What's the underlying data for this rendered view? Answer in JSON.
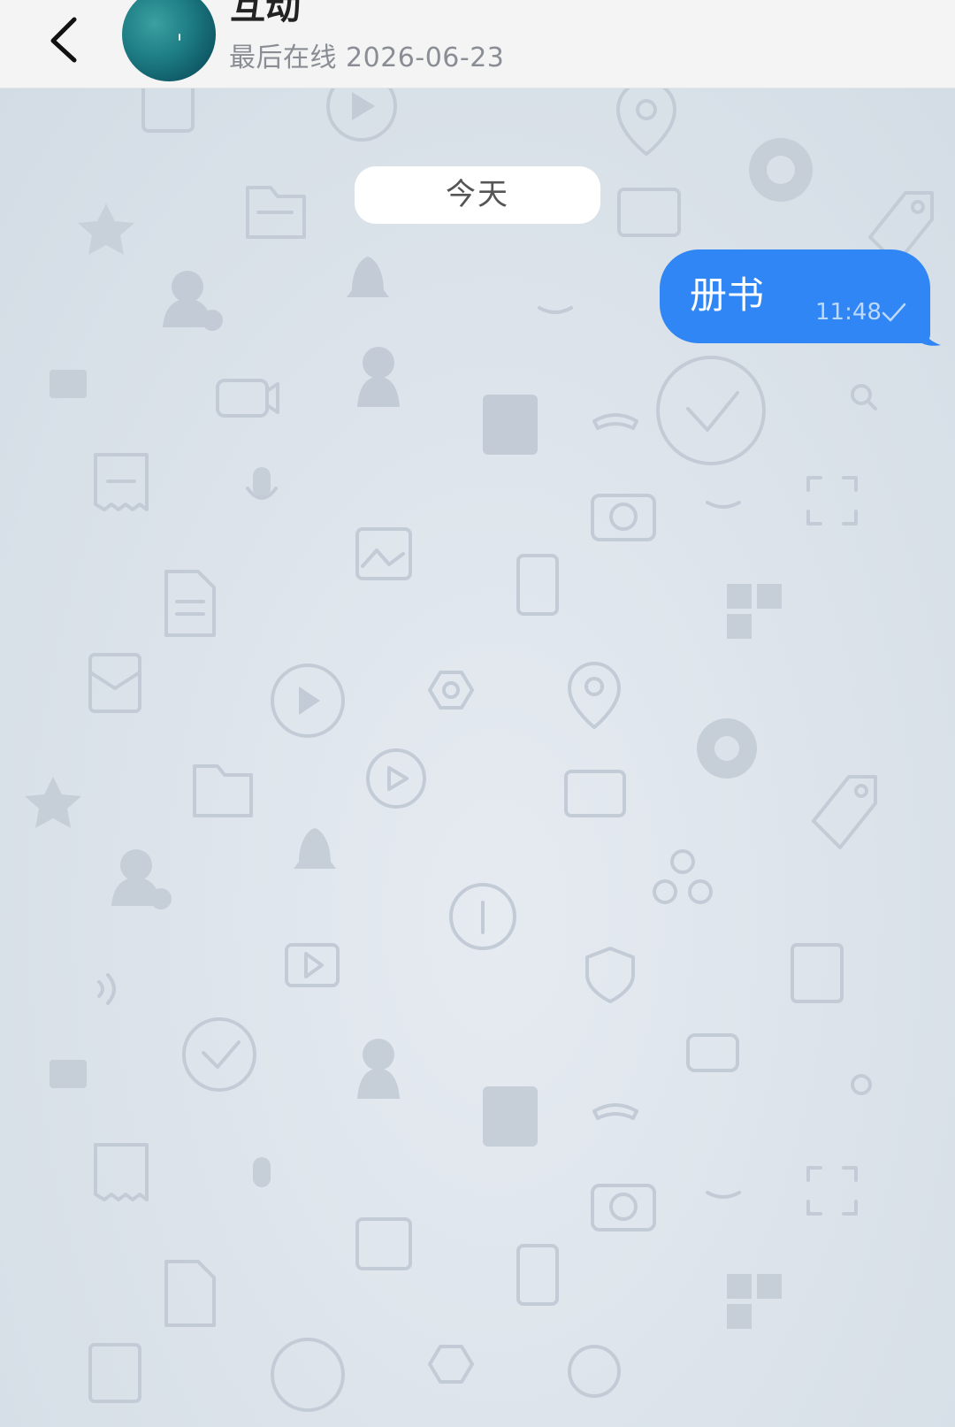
{
  "header": {
    "chat_name": "互动",
    "last_seen": "最后在线 2026-06-23"
  },
  "chat": {
    "date_separator": "今天",
    "messages": [
      {
        "text": "册书",
        "time": "11:48",
        "direction": "outgoing",
        "status": "delivered"
      }
    ]
  },
  "colors": {
    "header_bg": "#f4f4f5",
    "wallpaper_bg": "#d8e0e8",
    "outgoing_bubble": "#2f86f4",
    "date_pill_bg": "#ffffff"
  },
  "icons": {
    "back": "chevron-left-icon",
    "read_status": "check-icon"
  }
}
